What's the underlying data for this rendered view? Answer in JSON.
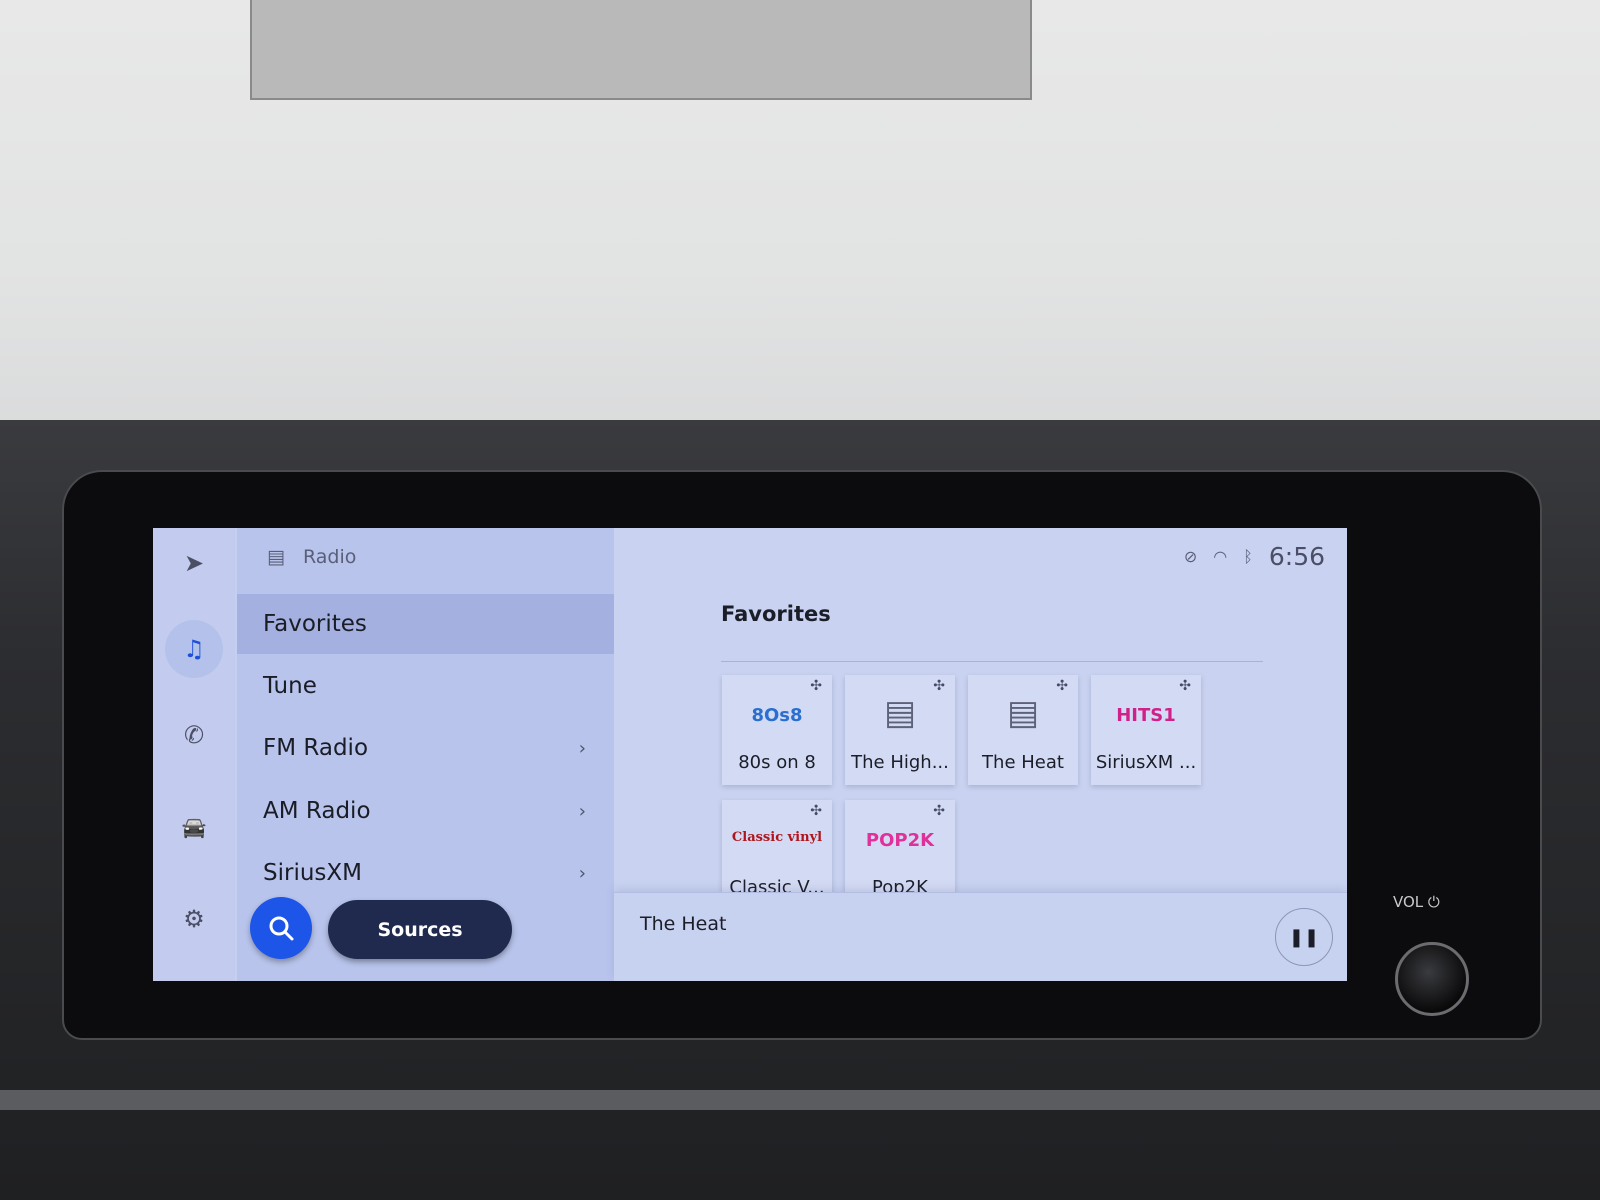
{
  "rail": {
    "items": [
      {
        "icon": "navigation-arrow-icon",
        "glyph": "➤"
      },
      {
        "icon": "music-note-icon",
        "glyph": "♫",
        "active": true
      },
      {
        "icon": "phone-icon",
        "glyph": "✆"
      },
      {
        "icon": "car-icon",
        "glyph": "🚘"
      },
      {
        "icon": "gear-icon",
        "glyph": "⚙"
      }
    ]
  },
  "menu": {
    "header": "Radio",
    "items": [
      {
        "label": "Favorites",
        "selected": true
      },
      {
        "label": "Tune"
      },
      {
        "label": "FM Radio",
        "chevron": "›"
      },
      {
        "label": "AM Radio",
        "chevron": "›"
      },
      {
        "label": "SiriusXM",
        "chevron": "›"
      }
    ],
    "sources_label": "Sources"
  },
  "status": {
    "clock": "6:56"
  },
  "favorites": {
    "title": "Favorites",
    "tiles": [
      {
        "name": "80s on 8",
        "logo": "8Os8",
        "logo_color": "#2a6fd0"
      },
      {
        "name": "The High...",
        "logo": "▤",
        "logo_color": "#5e6278"
      },
      {
        "name": "The Heat",
        "logo": "▤",
        "logo_color": "#5e6278"
      },
      {
        "name": "SiriusXM ...",
        "logo": "HITS1",
        "logo_color": "#d0208a"
      },
      {
        "name": "Classic V...",
        "logo": "Classic vinyl",
        "logo_color": "#b0141c"
      },
      {
        "name": "Pop2K",
        "logo": "POP2K",
        "logo_color": "#e0309a"
      }
    ]
  },
  "now_playing": {
    "title": "The Heat",
    "pause_glyph": "❚❚"
  },
  "hardware": {
    "vol_label": "VOL ⏻"
  },
  "colors": {
    "accent": "#1c55e8",
    "sources_button": "#1f2a4e",
    "selected_row": "#a4b0df"
  }
}
